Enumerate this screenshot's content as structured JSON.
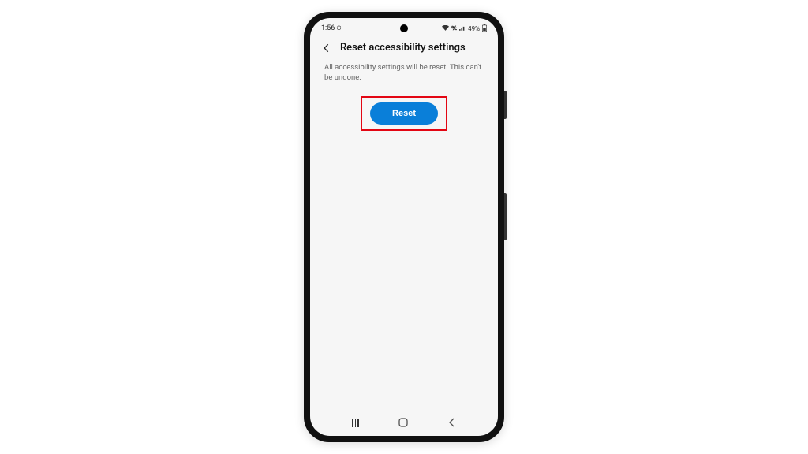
{
  "status_bar": {
    "time": "1:56",
    "battery_text": "49%"
  },
  "header": {
    "title": "Reset accessibility settings"
  },
  "content": {
    "description": "All accessibility settings will be reset. This can't be undone.",
    "reset_button_label": "Reset"
  },
  "colors": {
    "accent": "#0a7fd9",
    "highlight": "#e30613"
  }
}
